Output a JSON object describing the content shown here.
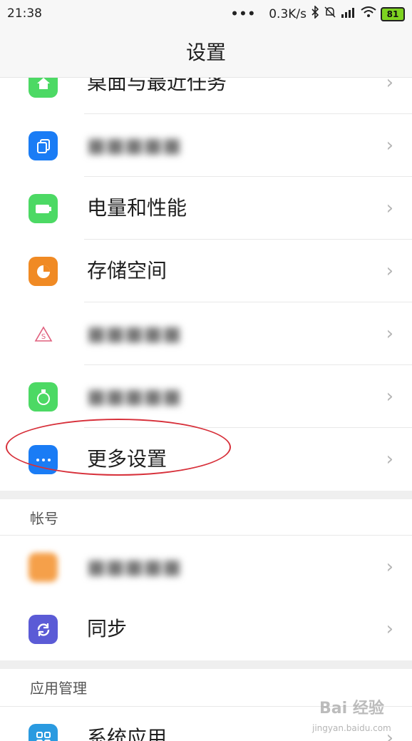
{
  "status_bar": {
    "time": "21:38",
    "dots": "•••",
    "speed": "0.3K/s",
    "bluetooth_icon": "bluetooth-icon",
    "mute_icon": "bell-off-icon",
    "signal_icon": "signal-icon",
    "wifi_icon": "wifi-icon",
    "battery": "81"
  },
  "header": {
    "title": "设置"
  },
  "rows": [
    {
      "label": "桌面与最近任务",
      "icon": "home-icon",
      "color": "#4cd964"
    },
    {
      "label": "",
      "icon": "copy-icon",
      "color": "#1a7cf5"
    },
    {
      "label": "电量和性能",
      "icon": "battery-icon",
      "color": "#4cd964"
    },
    {
      "label": "存储空间",
      "icon": "pie-chart-icon",
      "color": "#f08a24"
    },
    {
      "label": "",
      "icon": "s-triangle-icon",
      "color": "#ffffff"
    },
    {
      "label": "",
      "icon": "flask-icon",
      "color": "#4cd964"
    },
    {
      "label": "更多设置",
      "icon": "more-icon",
      "color": "#1a7cf5"
    }
  ],
  "account_section": {
    "title": "帐号"
  },
  "account_rows": [
    {
      "label": "",
      "icon": "account-icon",
      "color": "#f5a04a"
    },
    {
      "label": "同步",
      "icon": "sync-icon",
      "color": "#5b5bd6"
    }
  ],
  "apps_section": {
    "title": "应用管理"
  },
  "apps_rows": [
    {
      "label": "系统应用",
      "icon": "grid-icon",
      "color": "#2a9ae0"
    }
  ],
  "chevron": "›",
  "watermark": {
    "brand": "Bai 经验",
    "url": "jingyan.baidu.com"
  },
  "highlight_color": "#d7303a"
}
